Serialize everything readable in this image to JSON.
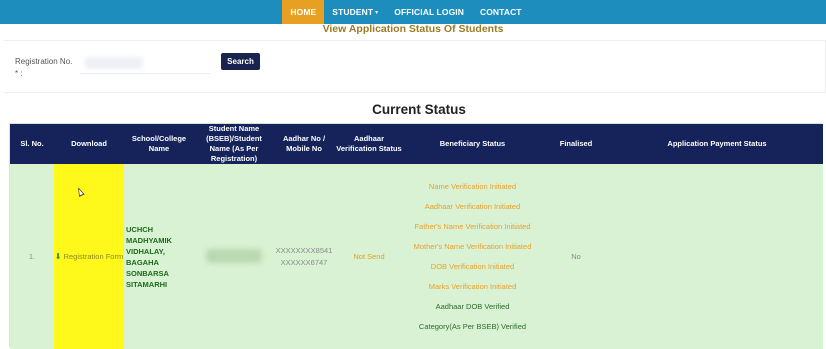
{
  "nav": {
    "items": [
      {
        "label": "HOME",
        "active": true
      },
      {
        "label": "STUDENT",
        "dropdown": true
      },
      {
        "label": "OFFICIAL LOGIN"
      },
      {
        "label": "CONTACT"
      }
    ],
    "caret": "▾",
    "colors": {
      "bar": "#1c8dbd",
      "active": "#e8a022"
    }
  },
  "page": {
    "section_title": "View Application Status Of Students"
  },
  "search": {
    "label": "Registration No. * :",
    "input_value": "",
    "button_label": "Search"
  },
  "status": {
    "heading": "Current Status",
    "columns": [
      "Sl. No.",
      "Download",
      "School/College Name",
      "Student Name (BSEB)/Student Name (As Per Registration)",
      "Aadhar No / Mobile No",
      "Aadhaar Verification Status",
      "Beneficiary Status",
      "Finalised",
      "Application Payment Status"
    ],
    "row": {
      "sl_no": "1.",
      "download_icon": "download-icon",
      "download_label": "Registration Form",
      "school_name": "UCHCH MADHYAMIK VIDHALAY, BAGAHA SONBARSA SITAMARHI",
      "student_name": "",
      "aadhar_no": "XXXXXXXX8541",
      "mobile_no": "XXXXXX6747",
      "aadhaar_verification": "Not Send",
      "beneficiary_status": [
        {
          "text": "Name Verification Initiated",
          "state": "pending"
        },
        {
          "text": "Aadhaar Verification Initiated",
          "state": "pending"
        },
        {
          "text": "Father's Name Verification Initiated",
          "state": "pending"
        },
        {
          "text": "Mother's Name Verification Initiated",
          "state": "pending"
        },
        {
          "text": "DOB Verification Initiated",
          "state": "pending"
        },
        {
          "text": "Marks Verification Initiated",
          "state": "pending"
        },
        {
          "text": "Aadhaar DOB Verified",
          "state": "done"
        },
        {
          "text": "Category(As Per BSEB) Verified",
          "state": "done"
        }
      ],
      "finalised": "No",
      "payment_status": ""
    },
    "colors": {
      "header": "#15235a",
      "row": "#d9f2d3",
      "download_cell": "#fff81a",
      "pending": "#e8a02a",
      "done": "#2c6b2c"
    }
  }
}
